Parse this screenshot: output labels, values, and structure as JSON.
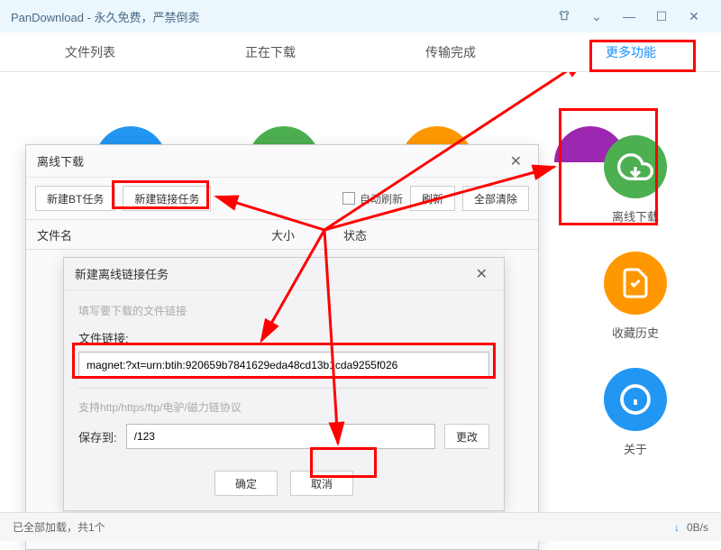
{
  "window": {
    "title": "PanDownload - 永久免费，严禁倒卖"
  },
  "tabs": {
    "filelist": "文件列表",
    "downloading": "正在下载",
    "completed": "传输完成",
    "more": "更多功能"
  },
  "sidebar": {
    "offline": "离线下载",
    "history": "收藏历史",
    "about": "关于"
  },
  "dialog1": {
    "title": "离线下载",
    "btn_new_bt": "新建BT任务",
    "btn_new_link": "新建链接任务",
    "check_auto_refresh": "自动刷新",
    "btn_refresh": "刷新",
    "btn_clear_all": "全部清除",
    "col_name": "文件名",
    "col_size": "大小",
    "col_status": "状态"
  },
  "dialog2": {
    "title": "新建离线链接任务",
    "hint": "填写要下载的文件链接",
    "label_link": "文件链接:",
    "link_value": "magnet:?xt=urn:btih:920659b7841629eda48cd13b1cda9255f026",
    "proto_hint": "支持http/https/ftp/电驴/磁力链协议",
    "label_save": "保存到:",
    "save_value": "/123",
    "btn_change": "更改",
    "btn_ok": "确定",
    "btn_cancel": "取消"
  },
  "status": {
    "loaded": "已全部加载，共1个",
    "speed": "0B/s"
  }
}
